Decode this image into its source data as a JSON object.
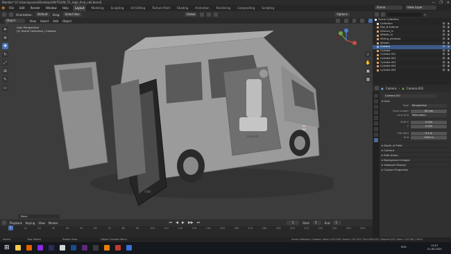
{
  "window": {
    "title": "Blender* [C:\\Users\\pcome\\Desktop\\VW-T5\\VW_T5_High_final_cell.blend]",
    "controls": [
      "—",
      "❐",
      "✕"
    ]
  },
  "menubar": {
    "items": [
      "File",
      "Edit",
      "Render",
      "Window",
      "Help"
    ],
    "workspaces": [
      "Layout",
      "Modeling",
      "Sculpting",
      "UV Editing",
      "Texture Paint",
      "Shading",
      "Animation",
      "Rendering",
      "Compositing",
      "Scripting"
    ],
    "active_workspace": "Layout",
    "scene": "Scene",
    "view_layer": "View Layer"
  },
  "viewport_header": {
    "orientation": "Orientation:",
    "orientation_value": "Default",
    "drag": "Drag:",
    "drag_value": "Select Box",
    "transform": "Global",
    "options": "Options"
  },
  "viewport_header2": {
    "mode": "Object Mode",
    "menus": [
      "View",
      "Select",
      "Add",
      "Object"
    ]
  },
  "viewport": {
    "info_line1": "User Perspective",
    "info_line2": "(1) Scene Collection | Camera",
    "logo_text": "VW",
    "side_text": "Dokanfo",
    "panel_label": "Move"
  },
  "timeline_header": {
    "menus": [
      "Playback",
      "Keying",
      "View",
      "Marker"
    ],
    "current_frame": "1",
    "start_label": "Start",
    "start_value": "1",
    "end_label": "End",
    "end_value": "1"
  },
  "timeline": {
    "frames": [
      "0",
      "10",
      "20",
      "30",
      "40",
      "50",
      "60",
      "70",
      "80",
      "90",
      "100",
      "110",
      "120",
      "130",
      "140",
      "150",
      "160",
      "170",
      "180",
      "190",
      "200",
      "210",
      "220",
      "230",
      "240",
      "250"
    ]
  },
  "statusbar": {
    "left": "Select",
    "mid1": "Box Select",
    "mid2": "Rotate View",
    "mid3": "Object Context Menu",
    "right": "Scene Collection | Camera | Verts:1,421,036 | Faces:1,101,519 | Tris:2,844,419 | Objects:1/25 | Mem: 1.03 GiB | 2.83.0"
  },
  "taskbar": {
    "time": "13:57",
    "date": "01.05.2020",
    "lang": "ENG"
  },
  "outliner": {
    "header": "Scene Collection",
    "rows": [
      {
        "label": "Collection",
        "sel": false,
        "color": "#e0e0e0"
      },
      {
        "label": "Day_8 exterior",
        "sel": false,
        "color": "#e0a060"
      },
      {
        "label": "Exterior_lv",
        "sel": false,
        "color": "#e0a060"
      },
      {
        "label": "Wheels_lv",
        "sel": false,
        "color": "#e0a060"
      },
      {
        "label": "Sliding_windows",
        "sel": false,
        "color": "#e0a060"
      },
      {
        "label": "Wheels",
        "sel": false,
        "color": "#e0a060"
      },
      {
        "label": "Camera",
        "sel": true,
        "color": "#8ab4f8"
      },
      {
        "label": "Cylinder",
        "sel": false,
        "color": "#e0a060"
      },
      {
        "label": "Cylinder.001",
        "sel": false,
        "color": "#e0a060"
      },
      {
        "label": "Cylinder.002",
        "sel": false,
        "color": "#e0a060"
      },
      {
        "label": "Cylinder.003",
        "sel": false,
        "color": "#e0a060"
      },
      {
        "label": "Cylinder.004",
        "sel": false,
        "color": "#e0a060"
      },
      {
        "label": "Cylinder.005",
        "sel": false,
        "color": "#e0a060"
      }
    ]
  },
  "properties": {
    "header_object": "Camera",
    "header_data": "Camera.001",
    "data_name": "Camera.001",
    "lens_panel": "Lens",
    "type_label": "Type",
    "type_value": "Perspective",
    "focal_label": "Focal Length",
    "focal_value": "50 mm",
    "lens_unit_label": "Lens Unit",
    "lens_unit_value": "Millimeters",
    "shift_x_label": "Shift X",
    "shift_x_value": "0.000",
    "shift_y_label": "Y",
    "shift_y_value": "0.000",
    "clip_start_label": "Clip Start",
    "clip_start_value": "0.1 m",
    "clip_end_label": "End",
    "clip_end_value": "1000 m",
    "collapsed": [
      "Depth of Field",
      "Camera",
      "Safe Areas",
      "Background Images",
      "Viewport Display",
      "Custom Properties"
    ]
  },
  "colors": {
    "accent": "#4772b3",
    "selected_row": "#3c5a8a",
    "viewport_bg": "#3c3c3c"
  }
}
